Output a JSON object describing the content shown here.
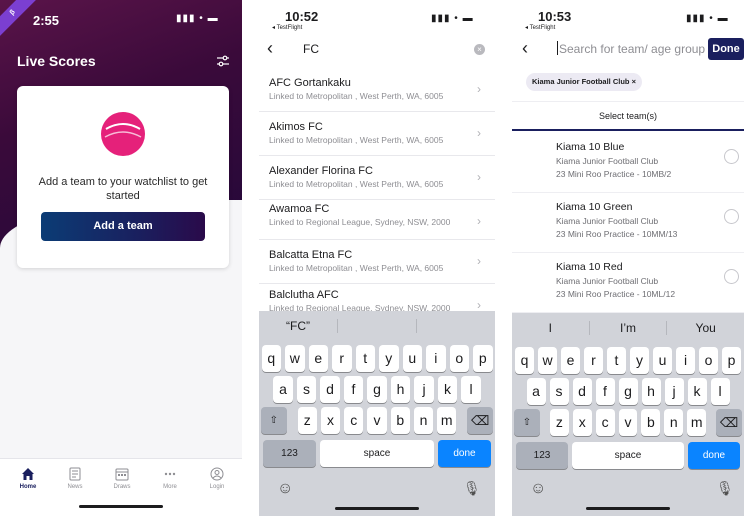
{
  "phone1": {
    "beta_label": "β",
    "status": {
      "time": "2:55",
      "icons": "▮▮▮ • ▬"
    },
    "title": "Live Scores",
    "card": {
      "message": "Add a team to your watchlist to get started",
      "button": "Add a team"
    },
    "tabs": [
      {
        "label": "Home",
        "icon": "home-icon"
      },
      {
        "label": "News",
        "icon": "news-icon"
      },
      {
        "label": "Draws",
        "icon": "draws-icon"
      },
      {
        "label": "More",
        "icon": "more-icon"
      },
      {
        "label": "Login",
        "icon": "login-icon"
      }
    ],
    "colors": {
      "accent": "#1a1f5e",
      "hero": "#3a0a3a",
      "ball": "#e5217a"
    }
  },
  "phone2": {
    "status": {
      "time": "10:52",
      "back_app": "◂ TestFlight",
      "icons": "▮▮▮ • ▬"
    },
    "search_value": "FC",
    "results": [
      {
        "name": "AFC Gortankaku",
        "sub": "Linked to Metropolitan , West Perth, WA, 6005"
      },
      {
        "name": "Akimos FC",
        "sub": "Linked to Metropolitan , West Perth, WA, 6005"
      },
      {
        "name": "Alexander Florina FC",
        "sub": "Linked to Metropolitan , West Perth, WA, 6005"
      },
      {
        "name": "Awamoa FC",
        "sub": "Linked to Regional League, Sydney, NSW, 2000"
      },
      {
        "name": "Balcatta Etna FC",
        "sub": "Linked to Metropolitan , West Perth, WA, 6005"
      },
      {
        "name": "Balclutha AFC",
        "sub": "Linked to Regional League, Sydney, NSW, 2000"
      }
    ],
    "keyboard": {
      "suggestions": [
        "“FC”",
        "",
        ""
      ],
      "row1": [
        "q",
        "w",
        "e",
        "r",
        "t",
        "y",
        "u",
        "i",
        "o",
        "p"
      ],
      "row2": [
        "a",
        "s",
        "d",
        "f",
        "g",
        "h",
        "j",
        "k",
        "l"
      ],
      "row3": [
        "z",
        "x",
        "c",
        "v",
        "b",
        "n",
        "m"
      ],
      "numbers": "123",
      "space": "space",
      "action": "done"
    }
  },
  "phone3": {
    "status": {
      "time": "10:53",
      "back_app": "◂ TestFlight",
      "icons": "▮▮▮ • ▬"
    },
    "search_placeholder": "Search for team/ age group",
    "done": "Done",
    "chip": "Kiama Junior Football Club  ×",
    "select_header": "Select team(s)",
    "teams": [
      {
        "name": "Kiama 10 Blue",
        "club": "Kiama Junior Football Club",
        "venue": "23 Mini Roo Practice - 10MB/2"
      },
      {
        "name": "Kiama 10 Green",
        "club": "Kiama Junior Football Club",
        "venue": "23 Mini Roo Practice - 10MM/13"
      },
      {
        "name": "Kiama 10 Red",
        "club": "Kiama Junior Football Club",
        "venue": "23 Mini Roo Practice - 10ML/12"
      }
    ],
    "keyboard": {
      "suggestions": [
        "I",
        "I’m",
        "You"
      ],
      "row1": [
        "q",
        "w",
        "e",
        "r",
        "t",
        "y",
        "u",
        "i",
        "o",
        "p"
      ],
      "row2": [
        "a",
        "s",
        "d",
        "f",
        "g",
        "h",
        "j",
        "k",
        "l"
      ],
      "row3": [
        "z",
        "x",
        "c",
        "v",
        "b",
        "n",
        "m"
      ],
      "numbers": "123",
      "space": "space",
      "action": "done"
    }
  }
}
